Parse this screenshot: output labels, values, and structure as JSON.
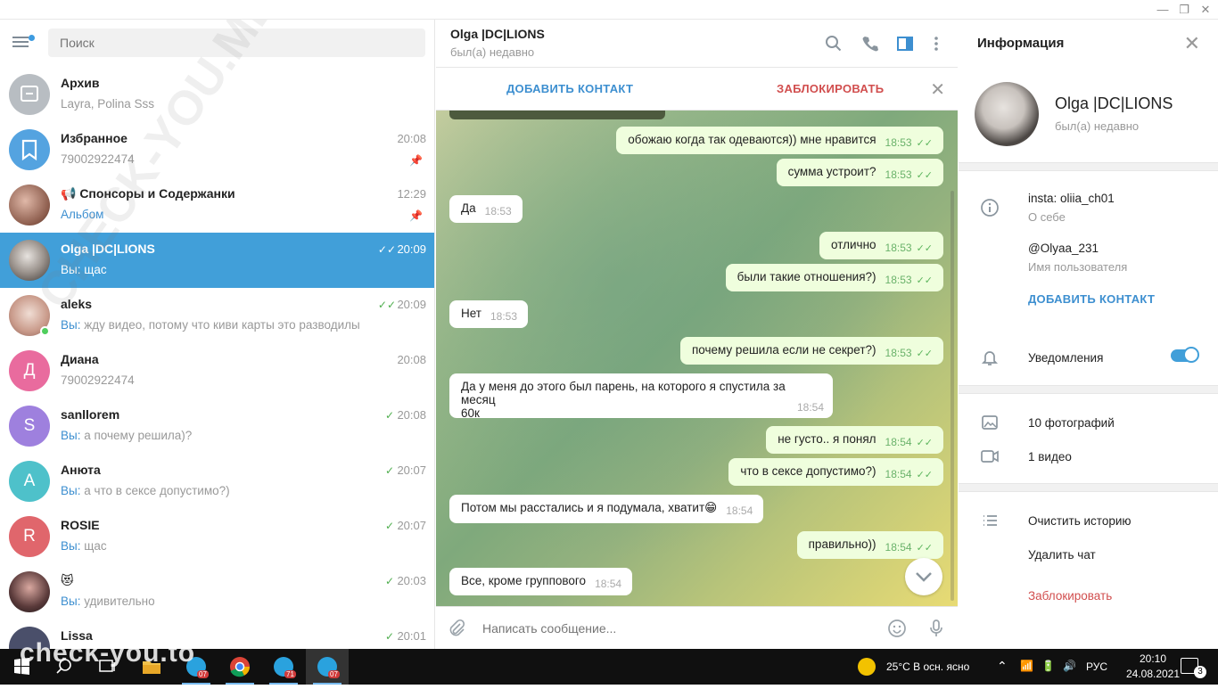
{
  "window": {
    "minimize": "—",
    "maximize": "❐",
    "close": "✕"
  },
  "sidebar": {
    "search_placeholder": "Поиск",
    "chats": [
      {
        "name": "Архив",
        "preview": "Layra, Polina Sss",
        "time": "",
        "avatar_color": "#b8bdc2",
        "avatar_letter": ""
      },
      {
        "name": "Избранное",
        "preview": "79002922474",
        "time": "20:08",
        "avatar_color": "#54a3e0",
        "avatar_letter": ""
      },
      {
        "name": "📢 Спонсоры и Содержанки",
        "preview": "Альбом",
        "time": "12:29",
        "avatar_color": "#b08a7a",
        "avatar_letter": ""
      },
      {
        "name": "Olga |DC|LIONS",
        "preview_prefix": "Вы:",
        "preview": " щас",
        "time": "20:09",
        "avatar_color": "#6a6360",
        "avatar_letter": ""
      },
      {
        "name": "aleks",
        "preview_prefix": "Вы:",
        "preview": " жду видео, потому что киви карты это разводилы",
        "time": "20:09",
        "avatar_color": "#c9a9a0",
        "avatar_letter": ""
      },
      {
        "name": "Диана",
        "preview": "79002922474",
        "time": "20:08",
        "avatar_color": "#e96b9e",
        "avatar_letter": "Д"
      },
      {
        "name": "sanllorem",
        "preview_prefix": "Вы:",
        "preview": " а почему решила)?",
        "time": "20:08",
        "avatar_color": "#9e80de",
        "avatar_letter": "S"
      },
      {
        "name": "Анюта",
        "preview_prefix": "Вы:",
        "preview": " а что в сексе допустимо?)",
        "time": "20:07",
        "avatar_color": "#4ec1ca",
        "avatar_letter": "А"
      },
      {
        "name": "ROSIE",
        "preview_prefix": "Вы:",
        "preview": " щас",
        "time": "20:07",
        "avatar_color": "#e0666c",
        "avatar_letter": "R"
      },
      {
        "name": "😻",
        "preview_prefix": "Вы:",
        "preview": " удивительно",
        "time": "20:03",
        "avatar_color": "#3a2e34",
        "avatar_letter": ""
      },
      {
        "name": "Lissa",
        "preview": "",
        "time": "20:01",
        "avatar_color": "#4a4f6a",
        "avatar_letter": ""
      }
    ]
  },
  "chat": {
    "title": "Olga |DC|LIONS",
    "status": "был(а) недавно",
    "add_contact": "ДОБАВИТЬ КОНТАКТ",
    "block": "ЗАБЛОКИРОВАТЬ",
    "compose_placeholder": "Написать сообщение...",
    "messages": [
      {
        "dir": "out",
        "text": "обожаю когда так одеваются)) мне нравится",
        "time": "18:53"
      },
      {
        "dir": "out",
        "text": "сумма устроит?",
        "time": "18:53"
      },
      {
        "dir": "in",
        "text": "Да",
        "time": "18:53"
      },
      {
        "dir": "out",
        "text": "отлично",
        "time": "18:53"
      },
      {
        "dir": "out",
        "text": "были такие отношения?)",
        "time": "18:53"
      },
      {
        "dir": "in",
        "text": "Нет",
        "time": "18:53"
      },
      {
        "dir": "out",
        "text": "почему решила если не секрет?)",
        "time": "18:53"
      },
      {
        "dir": "in",
        "text": "Да у меня до этого был парень, на которого я спустила за месяц",
        "text2": "60к",
        "time": "18:54"
      },
      {
        "dir": "out",
        "text": "не густо.. я понял",
        "time": "18:54"
      },
      {
        "dir": "out",
        "text": "что в сексе допустимо?)",
        "time": "18:54"
      },
      {
        "dir": "in",
        "text": "Потом мы расстались и я подумала, хватит😁",
        "time": "18:54"
      },
      {
        "dir": "out",
        "text": "правильно))",
        "time": "18:54"
      },
      {
        "dir": "in",
        "text": "Все, кроме группового",
        "time": "18:54"
      }
    ]
  },
  "info": {
    "title": "Информация",
    "name": "Olga |DC|LIONS",
    "status": "был(а) недавно",
    "bio": "insta: oliia_ch01",
    "bio_label": "О себе",
    "username": "@Olyaa_231",
    "username_label": "Имя пользователя",
    "add_contact": "ДОБАВИТЬ КОНТАКТ",
    "notifications": "Уведомления",
    "notifications_on": true,
    "photos": "10 фотографий",
    "videos": "1 видео",
    "clear_history": "Очистить историю",
    "delete_chat": "Удалить чат",
    "block": "Заблокировать"
  },
  "taskbar": {
    "weather": "25°C  В осн. ясно",
    "lang": "РУС",
    "time": "20:10",
    "date": "24.08.2021",
    "notif_count": "3",
    "badge1": "07",
    "badge2": "71",
    "badge3": "07"
  },
  "watermark": {
    "text": "check-you.to",
    "diag": "CHECK-YOU.ME"
  }
}
